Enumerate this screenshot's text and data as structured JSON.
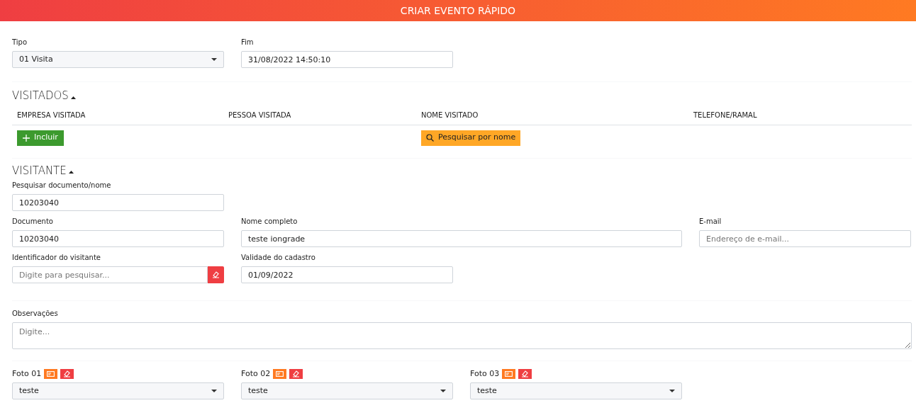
{
  "header": {
    "title": "CRIAR EVENTO RÁPIDO"
  },
  "top_fields": [
    {
      "kind": "select",
      "label": "Tipo",
      "value": "01 Visita"
    },
    {
      "kind": "input",
      "label": "Fim",
      "value": "31/08/2022 14:50:10"
    }
  ],
  "visitados": {
    "title": "VISITADOS",
    "expanded": true,
    "columns": [
      "EMPRESA VISITADA",
      "PESSOA VISITADA",
      "NOME VISITADO",
      "TELEFONE/RAMAL"
    ],
    "add_button": "Incluir",
    "search_button": "Pesquisar por nome"
  },
  "visitante": {
    "title": "VISITANTE",
    "expanded": true,
    "rows": [
      [
        {
          "kind": "input",
          "label": "Pesquisar documento/nome",
          "value": "10203040"
        }
      ],
      [
        {
          "kind": "input",
          "label": "Documento",
          "value": "10203040"
        },
        {
          "kind": "input",
          "label": "Nome completo",
          "value": "teste iongrade"
        },
        {
          "kind": "input",
          "label": "E-mail",
          "placeholder": "Endereço de e-mail..."
        }
      ],
      [
        {
          "kind": "clearable",
          "label": "Identificador do visitante",
          "placeholder": "Digite para pesquisar..."
        },
        {
          "kind": "input",
          "label": "Validade do cadastro",
          "value": "01/09/2022"
        }
      ]
    ]
  },
  "observacoes": {
    "label": "Observações",
    "placeholder": "Digite..."
  },
  "fotos": [
    {
      "label": "Foto 01",
      "value": "teste"
    },
    {
      "label": "Foto 02",
      "value": "teste"
    },
    {
      "label": "Foto 03",
      "value": "teste"
    }
  ]
}
